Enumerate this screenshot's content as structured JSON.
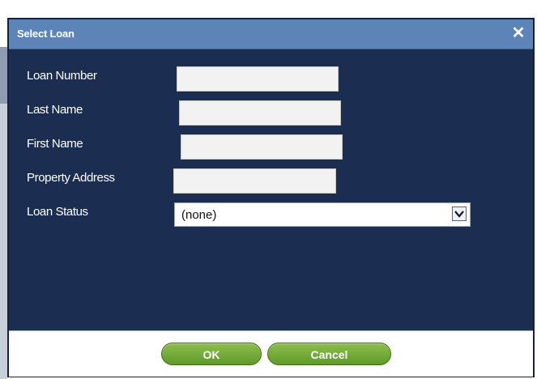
{
  "dialog": {
    "title": "Select Loan",
    "close_icon": "close-icon"
  },
  "form": {
    "loan_number": {
      "label": "Loan Number",
      "value": ""
    },
    "last_name": {
      "label": "Last Name",
      "value": ""
    },
    "first_name": {
      "label": "First Name",
      "value": ""
    },
    "property_address": {
      "label": "Property Address",
      "value": ""
    },
    "loan_status": {
      "label": "Loan Status",
      "selected": "(none)"
    }
  },
  "buttons": {
    "ok": "OK",
    "cancel": "Cancel"
  },
  "colors": {
    "dialog_bg": "#1c2d52",
    "titlebar": "#5c84b8",
    "button_green": "#6fa832"
  }
}
